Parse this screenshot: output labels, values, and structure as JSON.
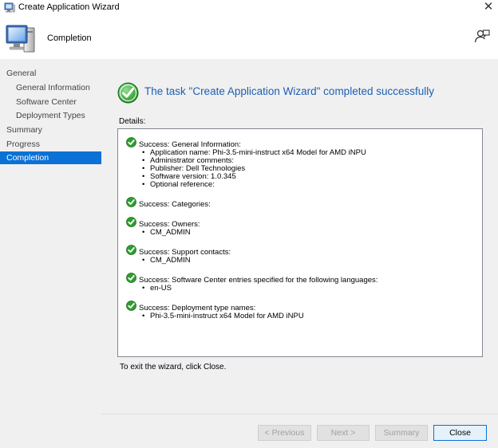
{
  "window": {
    "title": "Create Application Wizard",
    "close_glyph": "✕",
    "app_icon": "computer-icon",
    "help_icon": "person-help-icon"
  },
  "header": {
    "heading": "Completion"
  },
  "sidebar": {
    "items": [
      {
        "label": "General",
        "level": 0,
        "active": false
      },
      {
        "label": "General Information",
        "level": 1,
        "active": false
      },
      {
        "label": "Software Center",
        "level": 1,
        "active": false
      },
      {
        "label": "Deployment Types",
        "level": 1,
        "active": false
      },
      {
        "label": "Summary",
        "level": 0,
        "active": false
      },
      {
        "label": "Progress",
        "level": 0,
        "active": false
      },
      {
        "label": "Completion",
        "level": 0,
        "active": true
      }
    ]
  },
  "main": {
    "status_heading": "The task \"Create Application Wizard\" completed successfully",
    "details_label": "Details:",
    "exit_text": "To exit the wizard, click Close.",
    "details": [
      {
        "title": "Success: General Information:",
        "bullets": [
          "Application name: Phi-3.5-mini-instruct x64 Model for AMD iNPU",
          "Administrator comments:",
          "Publisher: Dell Technologies",
          "Software version: 1.0.345",
          "Optional reference:"
        ]
      },
      {
        "title": "Success: Categories:",
        "bullets": []
      },
      {
        "title": "Success: Owners:",
        "bullets": [
          "CM_ADMIN"
        ]
      },
      {
        "title": "Success: Support contacts:",
        "bullets": [
          "CM_ADMIN"
        ]
      },
      {
        "title": "Success: Software Center entries specified for the following languages:",
        "bullets": [
          "en-US"
        ]
      },
      {
        "title": "Success: Deployment type names:",
        "bullets": [
          "Phi-3.5-mini-instruct x64 Model for AMD iNPU"
        ]
      }
    ]
  },
  "buttons": {
    "previous": "< Previous",
    "next": "Next >",
    "summary": "Summary",
    "close": "Close"
  },
  "colors": {
    "accent": "#0a71d6",
    "heading_blue": "#1e5fb4",
    "success_green": "#2e9e2e"
  }
}
